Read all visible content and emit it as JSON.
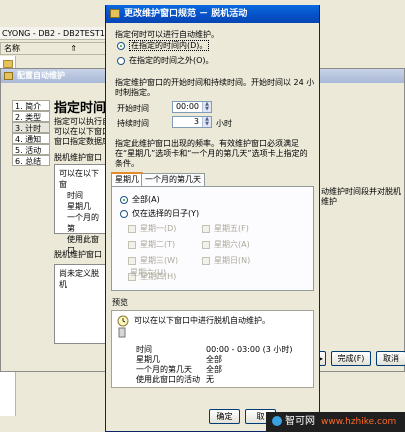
{
  "background": {
    "path_bar": "CYONG - DB2 - DB2TEST1",
    "column_header": "名称",
    "sort_glyph": "⇑",
    "tree_chars": [
      "别",
      "名",
      "类",
      "按",
      "一"
    ]
  },
  "wizard": {
    "title": "配置自动维护",
    "steps": [
      "1. 简介",
      "2. 类型",
      "3. 计时",
      "4. 通知",
      "5. 活动",
      "6. 总结"
    ],
    "heading": "指定时间",
    "desc_lines": [
      "指定可以执行自",
      "可以在以下窗口",
      "窗口指定数据库"
    ],
    "right_desc": "动维护时间段并对脱机维护",
    "group1_label": "脱机维护窗口",
    "box1_lines": [
      "可以在以下窗",
      "时间",
      "星期几",
      "一个月的第",
      "使用此窗口"
    ],
    "group2_label": "脱机维护窗口",
    "box2_lines": [
      "尚未定义脱机"
    ],
    "finish_label": "完成(F)",
    "cancel_label": "取消"
  },
  "dialog": {
    "title": "更改维护窗口规范 － 脱机活动",
    "close_glyph": "×",
    "when_label": "指定何时可以进行自动维护。",
    "radio_in": "在指定的时间内(D)。",
    "radio_out": "在指定的时间之外(O)。",
    "time_desc": "指定维护窗口的开始时间和持续时间。开始时间以 24 小时制指定。",
    "start_label": "开始时间",
    "start_value": "00:00",
    "duration_label": "持续时间",
    "duration_value": "3",
    "duration_unit": "小时",
    "freq_desc": "指定此维护窗口出现的频率。有效维护窗口必须满足在“星期几”选项卡和“一个月的第几天”选项卡上指定的条件。",
    "tabs": [
      "星期几",
      "一个月的第几天"
    ],
    "radio_all": "全部(A)",
    "radio_selected": "仅在选择的日子(Y)",
    "days_left": [
      "星期一(D)",
      "星期二(T)",
      "星期三(W)",
      "星期四(H)",
      "星期六(U)"
    ],
    "days_right": [
      "星期五(F)",
      "星期六(A)",
      "星期日(N)"
    ],
    "preview_label": "预览",
    "preview_desc": "可以在以下窗口中进行脱机自动维护。",
    "preview_rows": [
      {
        "label": "时间",
        "value": "00:00 - 03:00 (3 小时)"
      },
      {
        "label": "星期几",
        "value": "全部"
      },
      {
        "label": "一个月的第几天",
        "value": "全部"
      },
      {
        "label": "使用此窗口的活动",
        "value": "无"
      }
    ],
    "ok_label": "确定",
    "cancel_label": "取"
  },
  "watermark": {
    "text": "智可网",
    "url": "www.hzhike.com"
  },
  "colors": {
    "title_blue": "#0551c9",
    "xp_face": "#ece9d8",
    "radio_green": "#21a121",
    "tab_accent": "#e68b2c"
  }
}
